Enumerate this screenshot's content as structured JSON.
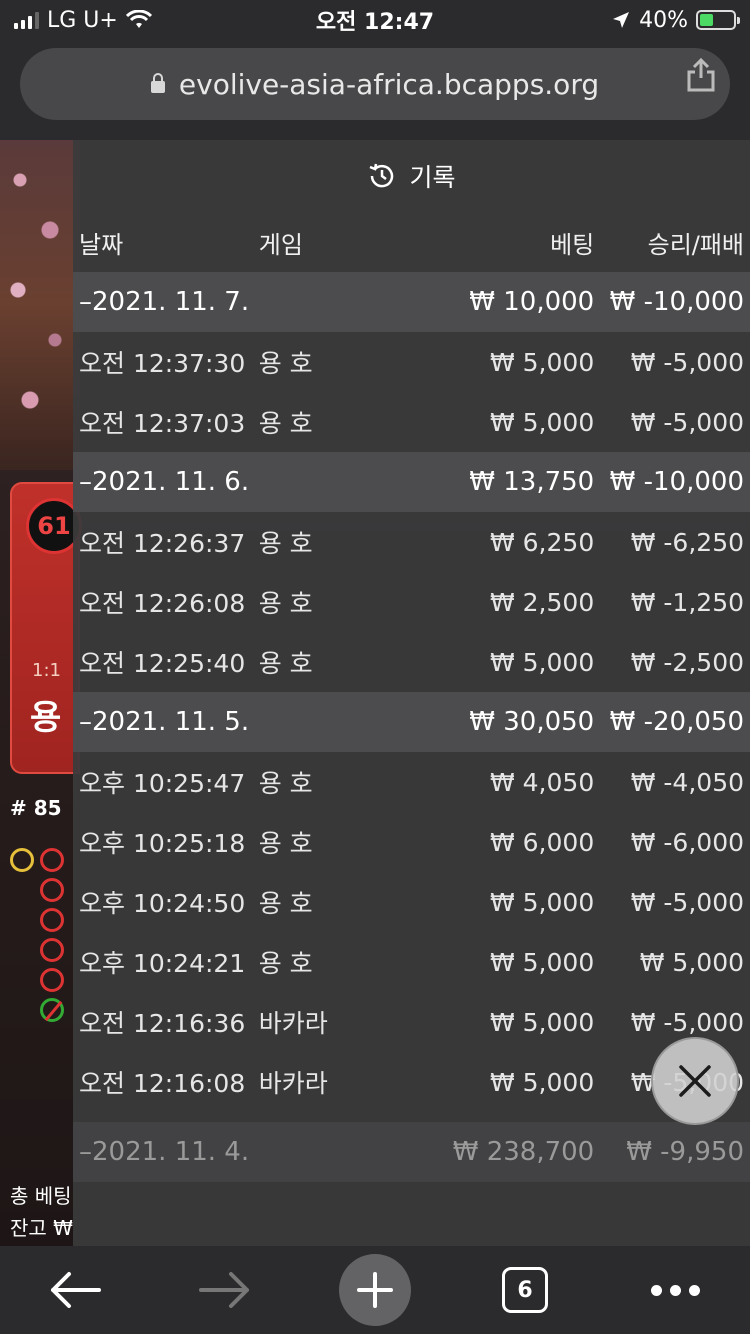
{
  "status_bar": {
    "carrier": "LG U+",
    "time": "오전 12:47",
    "battery_percent": "40%"
  },
  "browser": {
    "url": "evolive-asia-africa.bcapps.org",
    "tab_count": "6"
  },
  "game_background": {
    "card_number": "61",
    "payout": "1:1",
    "side_label": "용",
    "round": "# 85",
    "total_bet_label": "총 베팅",
    "balance_label": "잔고 ₩"
  },
  "history": {
    "title": "기록",
    "columns": {
      "date": "날짜",
      "game": "게임",
      "bet": "베팅",
      "win_loss": "승리/패배"
    },
    "groups": [
      {
        "date": "–2021. 11. 7.",
        "bet": "₩ 10,000",
        "result": "₩ -10,000",
        "rows": [
          {
            "time": "오전 12:37:30",
            "game": "용 호",
            "bet": "₩ 5,000",
            "result": "₩ -5,000"
          },
          {
            "time": "오전 12:37:03",
            "game": "용 호",
            "bet": "₩ 5,000",
            "result": "₩ -5,000"
          }
        ]
      },
      {
        "date": "–2021. 11. 6.",
        "bet": "₩ 13,750",
        "result": "₩ -10,000",
        "rows": [
          {
            "time": "오전 12:26:37",
            "game": "용 호",
            "bet": "₩ 6,250",
            "result": "₩ -6,250"
          },
          {
            "time": "오전 12:26:08",
            "game": "용 호",
            "bet": "₩ 2,500",
            "result": "₩ -1,250"
          },
          {
            "time": "오전 12:25:40",
            "game": "용 호",
            "bet": "₩ 5,000",
            "result": "₩ -2,500"
          }
        ]
      },
      {
        "date": "–2021. 11. 5.",
        "bet": "₩ 30,050",
        "result": "₩ -20,050",
        "rows": [
          {
            "time": "오후 10:25:47",
            "game": "용 호",
            "bet": "₩ 4,050",
            "result": "₩ -4,050"
          },
          {
            "time": "오후 10:25:18",
            "game": "용 호",
            "bet": "₩ 6,000",
            "result": "₩ -6,000"
          },
          {
            "time": "오후 10:24:50",
            "game": "용 호",
            "bet": "₩ 5,000",
            "result": "₩ -5,000"
          },
          {
            "time": "오후 10:24:21",
            "game": "용 호",
            "bet": "₩ 5,000",
            "result": "₩ 5,000"
          },
          {
            "time": "오전 12:16:36",
            "game": "바카라",
            "bet": "₩ 5,000",
            "result": "₩ -5,000"
          },
          {
            "time": "오전 12:16:08",
            "game": "바카라",
            "bet": "₩ 5,000",
            "result": "₩ -5,000"
          }
        ]
      },
      {
        "date": "–2021. 11. 4.",
        "bet": "₩ 238,700",
        "result": "₩ -9,950",
        "rows": []
      }
    ]
  },
  "icons": {
    "history": "history-clock-icon",
    "close": "close-icon",
    "back": "back-arrow-icon",
    "forward": "forward-arrow-icon",
    "new_tab": "plus-icon",
    "more": "more-dots-icon",
    "share": "share-icon",
    "lock": "lock-icon"
  }
}
